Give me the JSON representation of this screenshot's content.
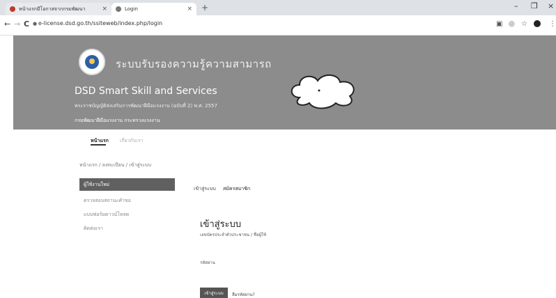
{
  "browser": {
    "tabs": [
      {
        "title": "หน้าแรกมีโอกาสจากกรมพัฒนา",
        "close": "×"
      },
      {
        "title": "Login",
        "close": "×"
      }
    ],
    "new_tab": "+",
    "window_controls": [
      "–",
      "❐",
      "×"
    ],
    "nav": {
      "back": "←",
      "forward": "→",
      "reload": "C"
    },
    "url": "e-license.dsd.go.th/ssiteweb/index.php/login"
  },
  "banner": {
    "system_title": "ระบบรับรองความรู้ความสามารถ",
    "app_title": "DSD Smart Skill and Services",
    "subtitle_1": "พระราชบัญญัติส่งเสริมการพัฒนาฝีมือแรงงาน (ฉบับที่ 2) พ.ศ. 2557",
    "subtitle_2": "กรมพัฒนาฝีมือแรงงาน กระทรวงแรงงาน"
  },
  "topnav": {
    "home": "หน้าแรก",
    "other": "เกี่ยวกับเรา"
  },
  "breadcrumb": "หน้าแรก / ลงทะเบียน / เข้าสู่ระบบ",
  "sidebar": {
    "active": "ผู้ใช้งานใหม่",
    "items": [
      "ตรวจสอบสถานะคำขอ",
      "แบบฟอร์มดาวน์โหลด",
      "ติดต่อเรา"
    ]
  },
  "main": {
    "tab_login": "เข้าสู่ระบบ",
    "tab_register": "สมัครสมาชิก",
    "heading": "เข้าสู่ระบบ",
    "username_label": "เลขบัตรประจำตัวประชาชน / ชื่อผู้ใช้",
    "password_label": "รหัสผ่าน",
    "login_button": "เข้าสู่ระบบ",
    "forgot_password": "ลืมรหัสผ่าน?"
  }
}
